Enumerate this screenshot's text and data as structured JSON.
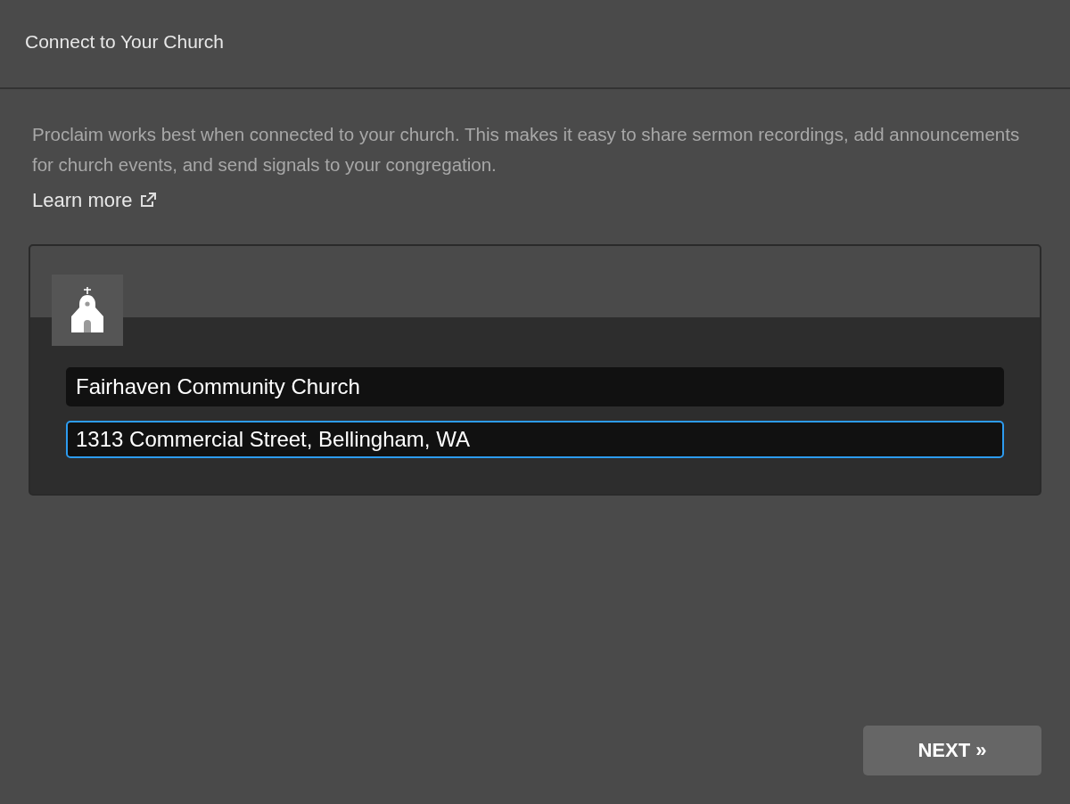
{
  "window": {
    "title": "Connect to Your Church"
  },
  "description": "Proclaim works best when connected to your church. This makes it easy to share sermon recordings, add announcements for church events, and send signals to your congregation.",
  "learn_more": {
    "label": "Learn more"
  },
  "church_fields": [
    {
      "value": "Fairhaven Community Church",
      "focused": false
    },
    {
      "value": "1313 Commercial Street, Bellingham, WA",
      "focused": true
    }
  ],
  "buttons": [
    {
      "label": "NEXT »"
    }
  ]
}
